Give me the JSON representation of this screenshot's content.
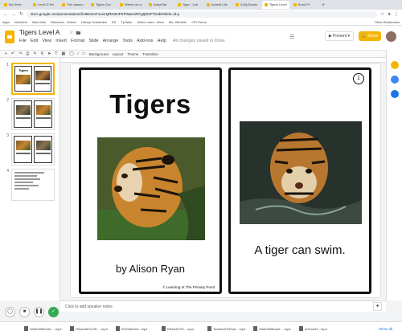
{
  "browser": {
    "tabs": [
      "My Drive",
      "Level D Re",
      "The classro",
      "Tigers Gra",
      "Where do w",
      "ArtsyPlat",
      "Tiger - Leb",
      "Animal Life",
      "A My Books",
      "Tigers Level",
      "Book Pr"
    ],
    "active_tab": 9,
    "url": "docs.google.com/presentation/d/1t8DxtAFonxeQRK8mPKPWavmRFgtjW2FTi/edit#slide=id.p",
    "bookmarks": [
      "Apps",
      "Wonders",
      "Miss Meu",
      "Welcome - Sched",
      "Library Schedules",
      "DS",
      "TpTalks",
      "Video Learn - Mem",
      "Ms. Wertzler",
      "CPI Home"
    ],
    "other_bookmarks": "Other Bookmarks"
  },
  "doc": {
    "title": "Tigers Level A",
    "menus": [
      "File",
      "Edit",
      "View",
      "Insert",
      "Format",
      "Slide",
      "Arrange",
      "Tools",
      "Add-ons",
      "Help"
    ],
    "saved_status": "All changes saved in Drive",
    "present_label": "Present",
    "share_label": "Share"
  },
  "toolbar": {
    "background_label": "Background",
    "layout_label": "Layout",
    "theme_label": "Theme",
    "transition_label": "Transition"
  },
  "filmstrip": {
    "slide_numbers": [
      "1",
      "2",
      "3",
      "4"
    ],
    "thumb_title": "Tigers"
  },
  "slide": {
    "left_title": "Tigers",
    "author": "by Alison Ryan",
    "credit": "© Learning At The Primary Pond",
    "page_number": "1",
    "sentence": "A tiger can swim."
  },
  "notes": {
    "placeholder": "Click to add speaker notes"
  },
  "downloads": {
    "files": [
      "whiteSl08bmet.....mp4",
      "HSanclbi7m4S.....mp4",
      "f2G0dbe5rd...mp4",
      "RAsSAC0S....mp4",
      "TowelsUFbDmd....mp4",
      "whiteSl08bmet.....mp4",
      "ai7bnsS4...mp4"
    ],
    "show_all": "Show all"
  },
  "colors": {
    "accent": "#f4b400",
    "present_border": "#dadce0",
    "green_button": "#34a853"
  }
}
